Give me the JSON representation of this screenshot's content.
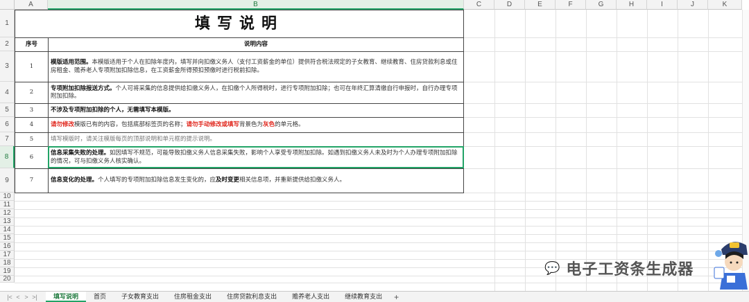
{
  "columns": [
    "A",
    "B",
    "C",
    "D",
    "E",
    "F",
    "G",
    "H",
    "I",
    "J",
    "K"
  ],
  "rows": [
    "1",
    "2",
    "3",
    "4",
    "5",
    "6",
    "7",
    "8",
    "9",
    "10",
    "11",
    "12",
    "13",
    "14",
    "15",
    "16",
    "17",
    "18",
    "19",
    "20"
  ],
  "title": "填写说明",
  "header": {
    "col1": "序号",
    "col2": "说明内容"
  },
  "items": [
    {
      "no": "1",
      "bold": "模版适用范围。",
      "text": "本模版适用于个人在扣除年度内，填写并向扣缴义务人（支付工资薪金的单位）提供符合税法规定的子女教育、继续教育、住房贷款利息或住房租金、赡养老人专项附加扣除信息，在工资薪金所得预扣预缴时进行税前扣除。"
    },
    {
      "no": "2",
      "bold": "专项附加扣除报送方式。",
      "text": "个人可将采集的信息提供给扣缴义务人，在扣缴个人所得税时，进行专项附加扣除；也可在年终汇算清缴自行申报时，自行办理专项附加扣除。"
    },
    {
      "no": "3",
      "bold": "不涉及专项附加扣除的个人，无需填写本模版。",
      "text": ""
    },
    {
      "no": "4",
      "red1": "请勿修改",
      "t1": "模版已有的内容，包括底部标签页的名称；",
      "red2": "请勿手动修改或填写",
      "t2": "背景色为",
      "red3": "灰色",
      "t3": "的单元格。"
    },
    {
      "no": "5",
      "text": "填写模版时，请关注模版每页的顶部说明和单元框的提示说明。"
    },
    {
      "no": "6",
      "bold": "信息采集失败的处理。",
      "text": "如因填写不规范，可能导致扣缴义务人信息采集失败，影响个人享受专项附加扣除。如遇到扣缴义务人未及时为个人办理专项附加扣除的情况，可与扣缴义务人核实确认。"
    },
    {
      "no": "7",
      "bold": "信息变化的处理。",
      "t1": "个人填写的专项附加扣除信息发生变化的，应",
      "bold2": "及时变更",
      "t2": "相关信息项，并重新提供给扣缴义务人。"
    }
  ],
  "sheet_tabs": [
    "填写说明",
    "首页",
    "子女教育支出",
    "住房租金支出",
    "住房贷款利息支出",
    "赡养老人支出",
    "继续教育支出"
  ],
  "active_tab": "填写说明",
  "watermark": "电子工资条生成器",
  "colors": {
    "accent": "#21a366",
    "red": "#e0251b"
  }
}
